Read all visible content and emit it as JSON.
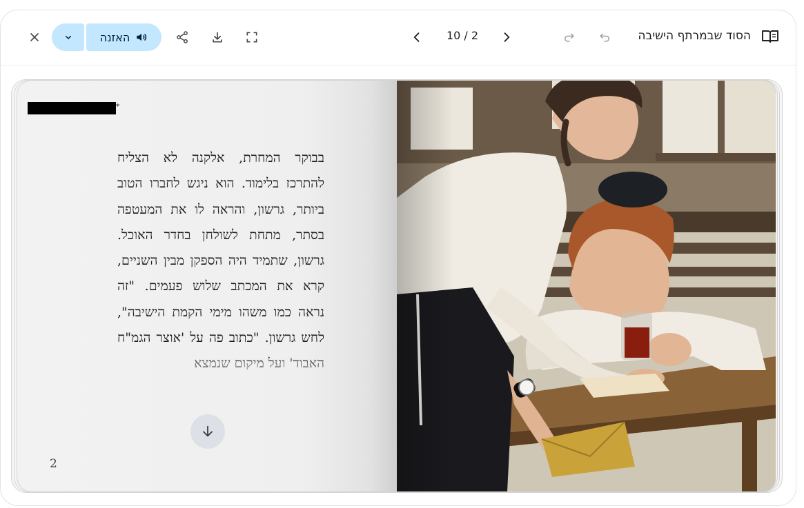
{
  "toolbar": {
    "title": "הסוד שבמרתף הישיבה",
    "page_counter": "10 / 2",
    "listen_label": "האזנה",
    "icons": {
      "close": "close-icon",
      "dropdown": "chevron-down-icon",
      "volume": "volume-icon",
      "share": "share-icon",
      "download": "download-icon",
      "fullscreen": "fullscreen-icon",
      "prev": "chevron-left-icon",
      "next": "chevron-right-icon",
      "redo": "redo-icon",
      "undo": "undo-icon",
      "book": "book-icon"
    }
  },
  "page": {
    "text": "בבוקר המחרת, אלקנה לא הצליח להתרכז בלימוד. הוא ניגש לחברו הטוב ביותר, גרשון, והראה לו את המעטפה בסתר, מתחת לשולחן בחדר האוכל. גרשון, שתמיד היה הספקן מבין השניים, קרא את המכתב שלוש פעמים. \"זה נראה כמו משהו מימי הקמת הישיבה\", לחש גרשון. \"כתוב פה על 'אוצר הגמ\"ח האבוד' ועל מיקום שנמצא",
    "page_number": "2",
    "illustration": "illustration-image",
    "scroll_icon": "arrow-down-icon"
  },
  "colors": {
    "listen_button": "#c2e7ff",
    "scroll_button": "#dde1e7",
    "page_bg": "#f2f2f2"
  }
}
